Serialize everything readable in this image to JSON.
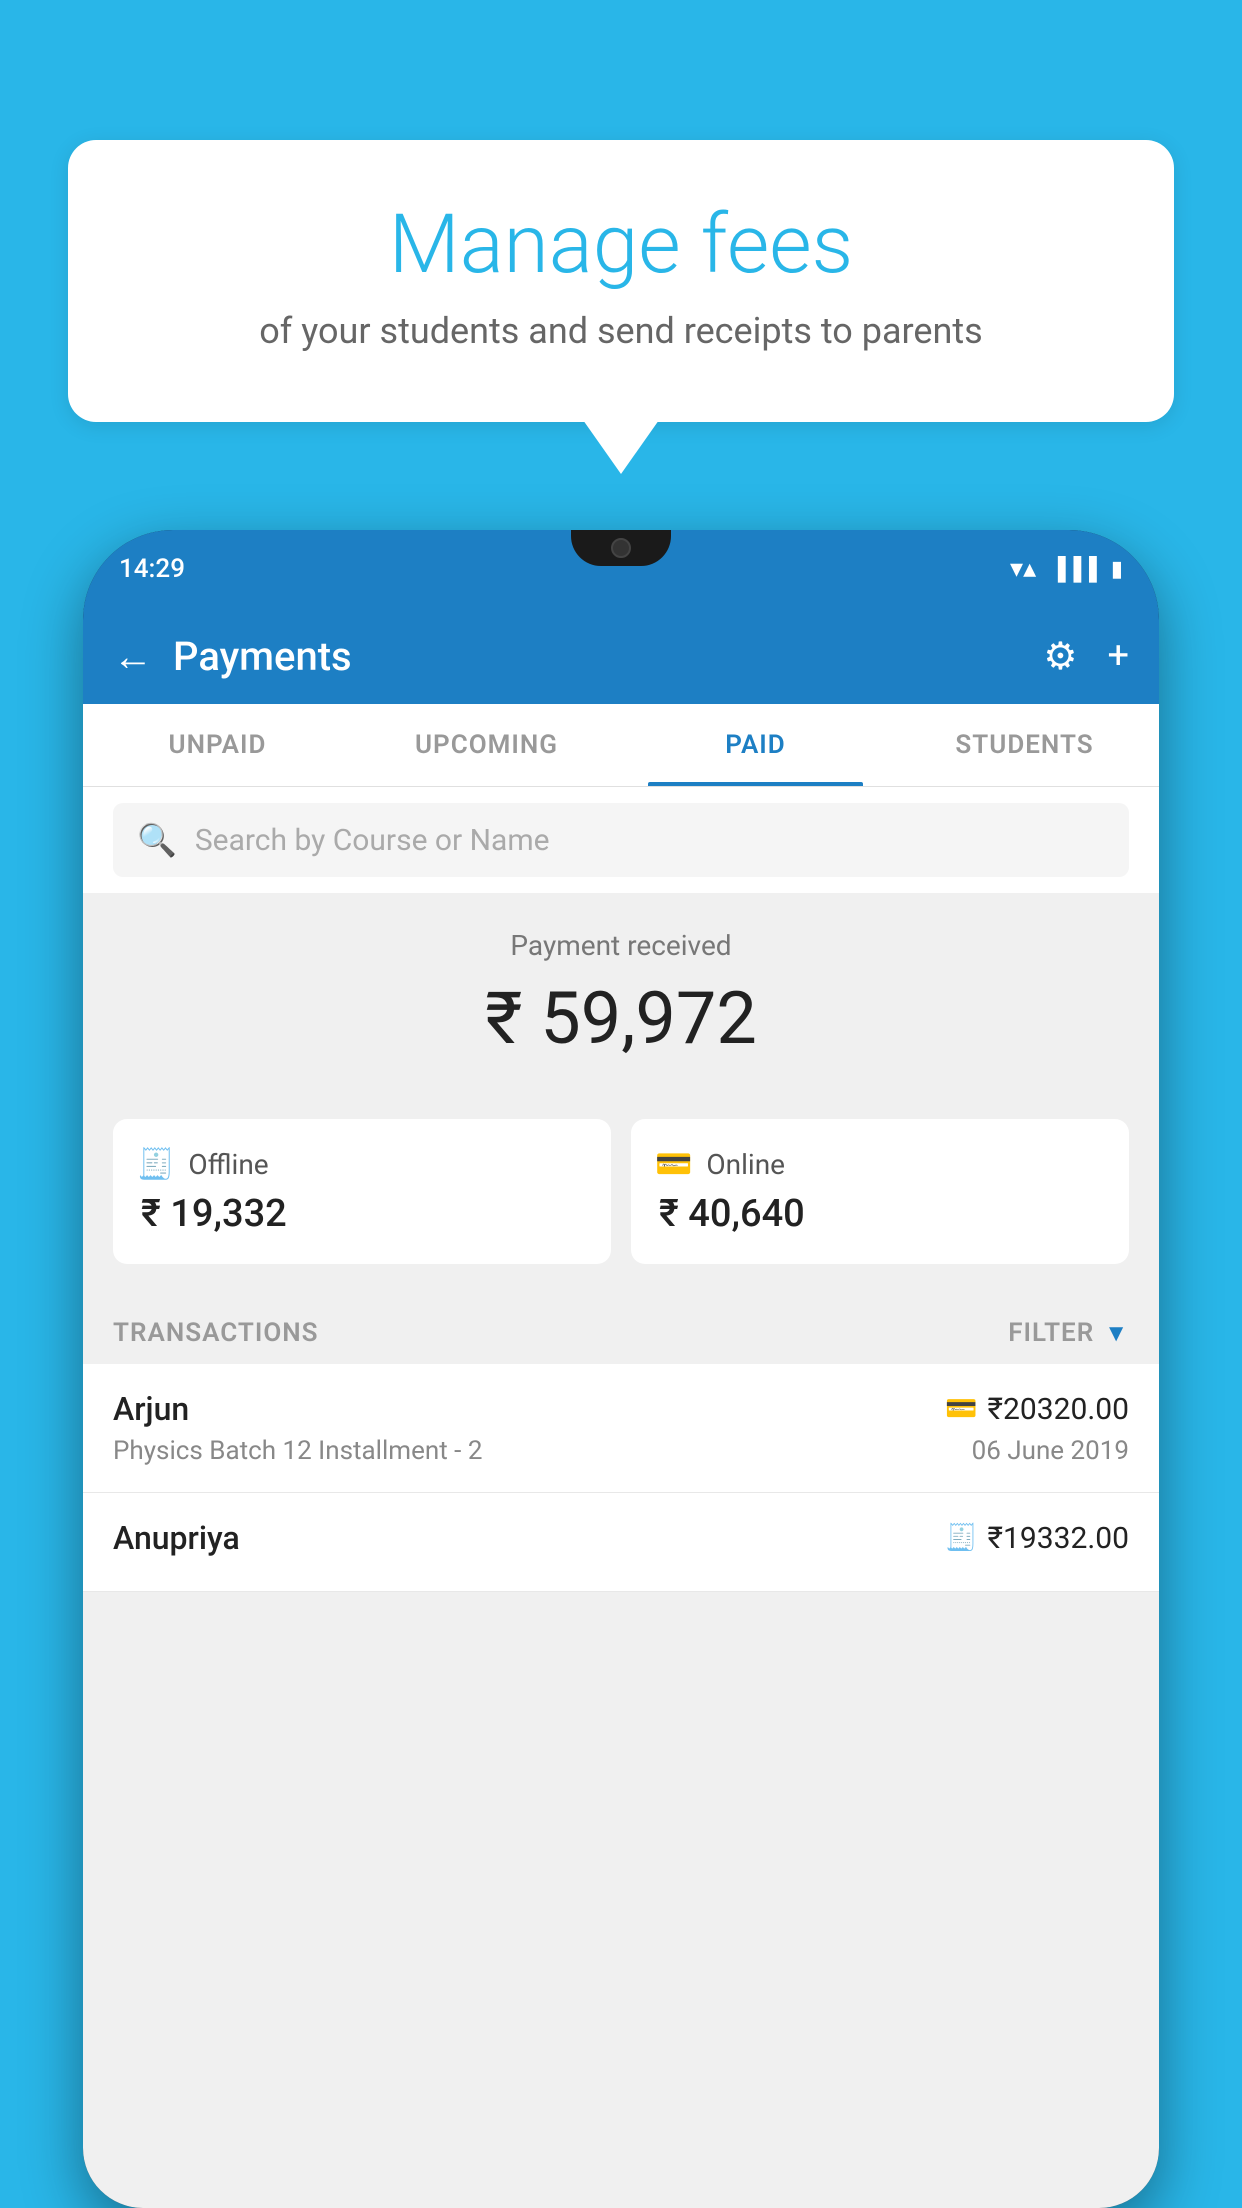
{
  "background": {
    "color": "#29b6e8"
  },
  "speech_bubble": {
    "title": "Manage fees",
    "subtitle": "of your students and send receipts to parents"
  },
  "phone": {
    "status_bar": {
      "time": "14:29"
    },
    "app_bar": {
      "title": "Payments",
      "back_icon": "←",
      "settings_icon": "⚙",
      "add_icon": "+"
    },
    "tabs": [
      {
        "label": "UNPAID",
        "active": false
      },
      {
        "label": "UPCOMING",
        "active": false
      },
      {
        "label": "PAID",
        "active": true
      },
      {
        "label": "STUDENTS",
        "active": false
      }
    ],
    "search": {
      "placeholder": "Search by Course or Name"
    },
    "payment_summary": {
      "label": "Payment received",
      "amount": "₹ 59,972",
      "offline_label": "Offline",
      "offline_amount": "₹ 19,332",
      "online_label": "Online",
      "online_amount": "₹ 40,640"
    },
    "transactions": {
      "section_label": "TRANSACTIONS",
      "filter_label": "FILTER",
      "items": [
        {
          "name": "Arjun",
          "amount": "₹20320.00",
          "course": "Physics Batch 12 Installment - 2",
          "date": "06 June 2019",
          "payment_type": "online"
        },
        {
          "name": "Anupriya",
          "amount": "₹19332.00",
          "course": "",
          "date": "",
          "payment_type": "offline"
        }
      ]
    }
  }
}
